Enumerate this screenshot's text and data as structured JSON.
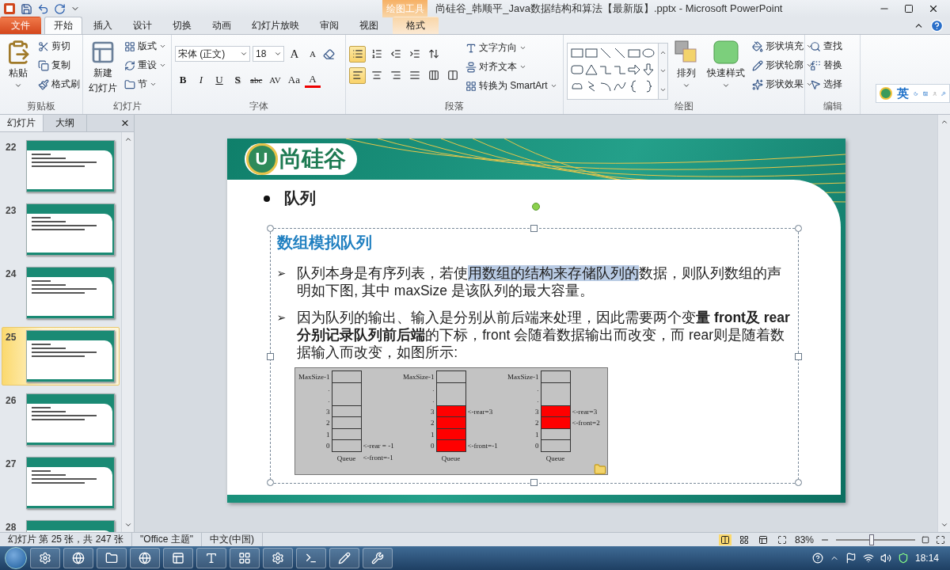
{
  "window": {
    "title": "尚硅谷_韩顺平_Java数据结构和算法【最新版】.pptx  -  Microsoft PowerPoint",
    "context_group": "绘图工具"
  },
  "tabs": [
    {
      "label": "文件",
      "kind": "file",
      "selected": false
    },
    {
      "label": "开始",
      "kind": "tab",
      "selected": true
    },
    {
      "label": "插入",
      "kind": "tab",
      "selected": false
    },
    {
      "label": "设计",
      "kind": "tab",
      "selected": false
    },
    {
      "label": "切换",
      "kind": "tab",
      "selected": false
    },
    {
      "label": "动画",
      "kind": "tab",
      "selected": false
    },
    {
      "label": "幻灯片放映",
      "kind": "tab",
      "selected": false
    },
    {
      "label": "审阅",
      "kind": "tab",
      "selected": false
    },
    {
      "label": "视图",
      "kind": "tab",
      "selected": false
    },
    {
      "label": "格式",
      "kind": "context",
      "selected": false
    }
  ],
  "ribbon": {
    "clipboard": {
      "title": "剪贴板",
      "paste": "粘贴",
      "items": [
        "剪切",
        "复制",
        "格式刷"
      ]
    },
    "slides": {
      "title": "幻灯片",
      "new_slide": "新建",
      "new_slide_2": "幻灯片",
      "items": [
        "版式",
        "重设",
        "节"
      ]
    },
    "font": {
      "title": "字体",
      "font_name": "宋体 (正文)",
      "font_size": "18",
      "grow": "A",
      "shrink": "A",
      "buttons": [
        {
          "label": "B",
          "kind": "bold"
        },
        {
          "label": "I",
          "kind": "italic"
        },
        {
          "label": "U",
          "kind": "underline"
        },
        {
          "label": "S",
          "kind": "shadow"
        },
        {
          "label": "abc",
          "kind": "strike"
        },
        {
          "label": "AV",
          "kind": "spacing"
        },
        {
          "label": "Aa",
          "kind": "case"
        },
        {
          "label": "A",
          "kind": "color"
        }
      ]
    },
    "paragraph": {
      "title": "段落",
      "row_1": [
        {
          "kind": "bullets",
          "on": true
        },
        {
          "kind": "numbering",
          "on": false
        },
        {
          "kind": "outdent",
          "on": false
        },
        {
          "kind": "indent",
          "on": false
        },
        {
          "kind": "spacing",
          "on": false
        }
      ],
      "row_2": [
        {
          "kind": "left",
          "on": true
        },
        {
          "kind": "center",
          "on": false
        },
        {
          "kind": "right",
          "on": false
        },
        {
          "kind": "justify",
          "on": false
        },
        {
          "kind": "distribute",
          "on": false
        },
        {
          "kind": "columns",
          "on": false
        }
      ],
      "items": [
        "文字方向",
        "对齐文本",
        "转换为 SmartArt"
      ]
    },
    "drawing": {
      "title": "绘图",
      "arrange": "排列",
      "quick_styles": "快速样式",
      "items": [
        "形状填充",
        "形状轮廓",
        "形状效果"
      ]
    },
    "editing": {
      "title": "编辑",
      "items": [
        "查找",
        "替换",
        "选择"
      ]
    }
  },
  "ime_bar": {
    "label": "英"
  },
  "slide_panel": {
    "tabs": [
      {
        "label": "幻灯片",
        "selected": true
      },
      {
        "label": "大纲",
        "selected": false
      }
    ],
    "close": "×",
    "slides": [
      {
        "number": "22",
        "selected": false
      },
      {
        "number": "23",
        "selected": false
      },
      {
        "number": "24",
        "selected": false
      },
      {
        "number": "25",
        "selected": true
      },
      {
        "number": "26",
        "selected": false
      },
      {
        "number": "27",
        "selected": false
      },
      {
        "number": "28",
        "selected": false
      }
    ]
  },
  "slide": {
    "logo_mark": "U",
    "logo": "尚硅谷",
    "bullet": "队列",
    "title": "数组模拟队列",
    "paragraph_1_mark": "➢",
    "paragraph_2_mark": "➢",
    "paragraph_1": [
      {
        "text": "队列本身是有序列表，若使",
        "highlighted": false
      },
      {
        "text": "用数组的结构来存储队列的",
        "highlighted": true
      },
      {
        "text": "数据，则队列数组的声明如下图, 其中 maxSize 是该队列的最大容量。",
        "highlighted": false
      }
    ],
    "paragraph_2": "因为队列的输出、输入是分别从前后端来处理，因此需要两个变**量 front及 rear分别记录队列前后端**的下标，front 会随着数据输出而改变，而 rear则是随着数据输入而改变，如图所示:",
    "diagram": {
      "stacks": [
        {
          "top": "MaxSize-1",
          "dots": [
            ".",
            "."
          ],
          "caption": "Queue",
          "below": "<-front=-1",
          "rows": [
            {
              "index": "3",
              "filled": false
            },
            {
              "index": "2",
              "filled": false
            },
            {
              "index": "1",
              "filled": false
            },
            {
              "index": "0",
              "filled": false,
              "pointer": "<-rear = -1"
            }
          ]
        },
        {
          "top": "MaxSize-1",
          "dots": [
            ".",
            "."
          ],
          "caption": "Queue",
          "rows": [
            {
              "index": "3",
              "filled": true,
              "pointer": "<-rear=3"
            },
            {
              "index": "2",
              "filled": true
            },
            {
              "index": "1",
              "filled": true
            },
            {
              "index": "0",
              "filled": true,
              "pointer": "<-front=-1"
            }
          ]
        },
        {
          "top": "MaxSize-1",
          "dots": [
            ".",
            "."
          ],
          "caption": "Queue",
          "rows": [
            {
              "index": "3",
              "filled": true,
              "pointer": "<-rear=3"
            },
            {
              "index": "2",
              "filled": true,
              "pointer": "<-front=2"
            },
            {
              "index": "1",
              "filled": false
            },
            {
              "index": "0",
              "filled": false
            }
          ]
        }
      ]
    }
  },
  "status_bar": {
    "slide_info": "幻灯片 第 25 张，共 247 张",
    "theme": "\"Office 主题\"",
    "language": "中文(中国)",
    "zoom": "83%",
    "zoom_slider": {
      "level": 0.45
    }
  },
  "taskbar": {
    "clock": "18:14"
  }
}
